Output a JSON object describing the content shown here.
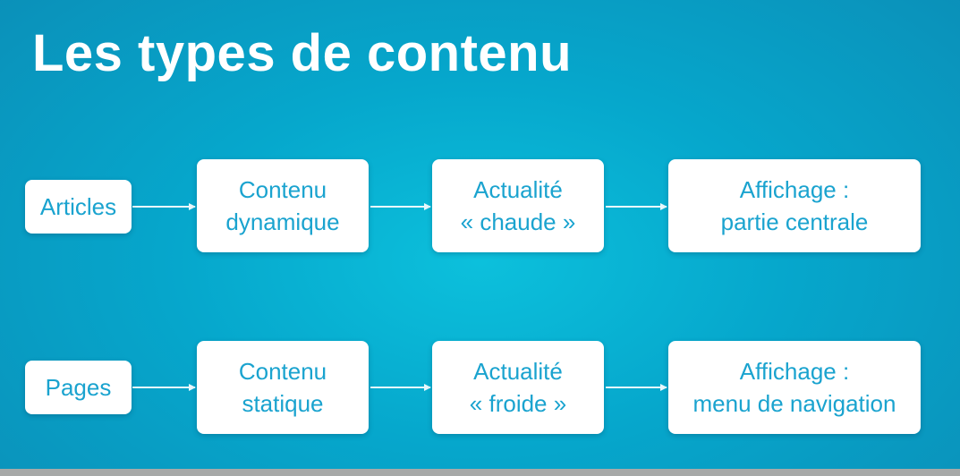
{
  "title": "Les types de contenu",
  "colors": {
    "background": "#06a7cc",
    "node_fill": "#ffffff",
    "node_text": "#1aa3cf",
    "arrow": "#e8f8fc",
    "title_text": "#ffffff"
  },
  "rows": [
    {
      "source": "Articles",
      "content": [
        "Contenu",
        "dynamique"
      ],
      "news": [
        "Actualité",
        "« chaude »"
      ],
      "display": [
        "Affichage :",
        "partie centrale"
      ]
    },
    {
      "source": "Pages",
      "content": [
        "Contenu",
        "statique"
      ],
      "news": [
        "Actualité",
        "« froide »"
      ],
      "display": [
        "Affichage :",
        "menu de navigation"
      ]
    }
  ]
}
